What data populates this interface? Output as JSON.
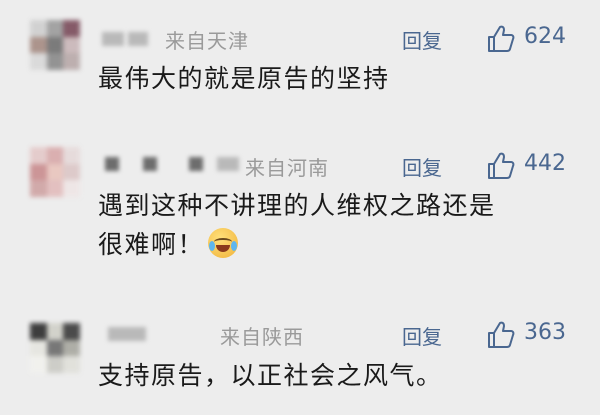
{
  "ui": {
    "reply_label": "回复",
    "accent_color": "#4a6790",
    "like_icon": "thumbs-up-outline-icon"
  },
  "comments": [
    {
      "location": "来自天津",
      "likes": "624",
      "text_lines": [
        "最伟大的就是原告的坚持"
      ],
      "emoji": null
    },
    {
      "location": "来自河南",
      "likes": "442",
      "text_lines": [
        "遇到这种不讲理的人维权之路还是",
        "很难啊！"
      ],
      "emoji": "crying-laughing-emoji"
    },
    {
      "location": "来自陕西",
      "likes": "363",
      "text_lines": [
        "支持原告，以正社会之风气。"
      ],
      "emoji": null
    }
  ]
}
